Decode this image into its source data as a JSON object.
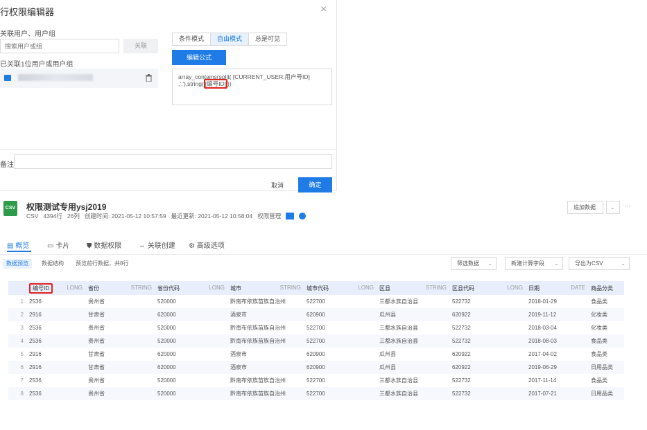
{
  "dialog": {
    "title": "行权限编辑器",
    "close_glyph": "×",
    "link_section_label": "关联用户、用户组",
    "search_placeholder": "搜索用户或组",
    "link_button": "关联",
    "linked_count_label": "已关联1位用户或用户组",
    "tabs": [
      "条件模式",
      "自由模式",
      "总是可见"
    ],
    "active_tab": "自由模式",
    "edit_formula_button": "编辑公式",
    "formula_part1": "array_contains(split( [CURRENT_USER.用户号ID]",
    "formula_part2": ",','),string(",
    "formula_highlight": "[编号ID]",
    "formula_part3": "))",
    "remark_label": "备注",
    "cancel_button": "取消",
    "confirm_button": "确定"
  },
  "dataset": {
    "badge": "CSV",
    "title": "权限测试专用ysj2019",
    "type": "CSV",
    "rows": "4394行",
    "cols": "26列",
    "created_label": "创建时间:",
    "created": "2021-05-12 10:57:59",
    "updated_label": "最近更新:",
    "updated": "2021-05-12 10:58:04",
    "permission_label": "权限管理",
    "add_data_button": "追加数据",
    "more_glyph": "···"
  },
  "nav_tabs": [
    "概览",
    "卡片",
    "数据权限",
    "关联创建",
    "高级选项"
  ],
  "sub_tabs": [
    "数据预览",
    "数据结构"
  ],
  "preview_note": "预览前行数据，共8行",
  "toolbar_buttons": [
    "筛选数据",
    "新建计算字段",
    "导出为CSV"
  ],
  "columns": [
    {
      "name": "编号ID",
      "type": "LONG"
    },
    {
      "name": "省份",
      "type": "STRING"
    },
    {
      "name": "省份代码",
      "type": "LONG"
    },
    {
      "name": "城市",
      "type": "STRING"
    },
    {
      "name": "城市代码",
      "type": "LONG"
    },
    {
      "name": "区县",
      "type": "STRING"
    },
    {
      "name": "区县代码",
      "type": "LONG"
    },
    {
      "name": "日期",
      "type": "DATE"
    },
    {
      "name": "商品分类",
      "type": ""
    }
  ],
  "rows": [
    [
      "1",
      "2536",
      "贵州省",
      "520000",
      "黔南布依族苗族自治州",
      "522700",
      "三都水族自治县",
      "522732",
      "2018-01-29",
      "食品类"
    ],
    [
      "2",
      "2916",
      "甘肃省",
      "620000",
      "酒泉市",
      "620900",
      "瓜州县",
      "620922",
      "2019-11-12",
      "化妆类"
    ],
    [
      "3",
      "2536",
      "贵州省",
      "520000",
      "黔南布依族苗族自治州",
      "522700",
      "三都水族自治县",
      "522732",
      "2018-03-04",
      "化妆类"
    ],
    [
      "4",
      "2536",
      "贵州省",
      "520000",
      "黔南布依族苗族自治州",
      "522700",
      "三都水族自治县",
      "522732",
      "2018-08-03",
      "食品类"
    ],
    [
      "5",
      "2916",
      "甘肃省",
      "620000",
      "酒泉市",
      "620900",
      "瓜州县",
      "620922",
      "2017-04-02",
      "食品类"
    ],
    [
      "6",
      "2916",
      "甘肃省",
      "620000",
      "酒泉市",
      "620900",
      "瓜州县",
      "620922",
      "2019-06-29",
      "日用品类"
    ],
    [
      "7",
      "2536",
      "贵州省",
      "520000",
      "黔南布依族苗族自治州",
      "522700",
      "三都水族自治县",
      "522732",
      "2017-11-14",
      "食品类"
    ],
    [
      "8",
      "2536",
      "贵州省",
      "520000",
      "黔南布依族苗族自治州",
      "522700",
      "三都水族自治县",
      "522732",
      "2017-07-21",
      "日用品类"
    ]
  ],
  "colors": {
    "accent": "#1f7ce6",
    "highlight": "#e0241f",
    "csv_green": "#2e9b4b"
  }
}
